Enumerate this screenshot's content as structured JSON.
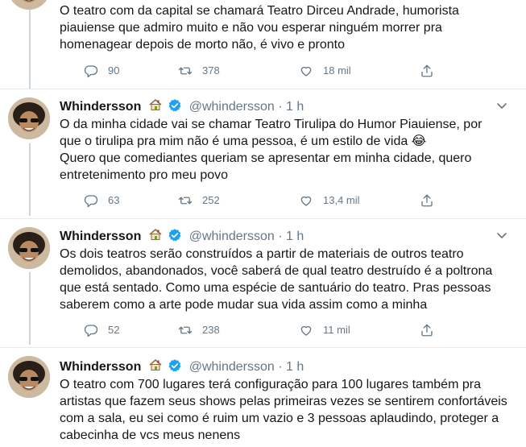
{
  "tweets": [
    {
      "show_header": false,
      "lines": [
        "O teatro com da capital se chamará Teatro Dirceu Andrade, humorista",
        "piauiense que admiro muito e não vou esperar ninguém morrer pra",
        "homenagear depois de morto não, é vivo e pronto"
      ],
      "replies": "90",
      "retweets": "378",
      "likes": "18 mil"
    },
    {
      "show_header": true,
      "name": "Whindersson",
      "handle": "@whindersson",
      "dot": "·",
      "time": "1 h",
      "lines": [
        "O da minha cidade vai se chamar Teatro Tirulipa do Humor Piauiense, por",
        "que o tirulipa pra mim não é uma pessoa, é um estilo de vida 😂",
        "Quero que comediantes queriam se apresentar em minha cidade, quero",
        "entretenimento pro meu povo"
      ],
      "replies": "63",
      "retweets": "252",
      "likes": "13,4 mil"
    },
    {
      "show_header": true,
      "name": "Whindersson",
      "handle": "@whindersson",
      "dot": "·",
      "time": "1 h",
      "lines": [
        "Os dois teatros serão construídos a partir de materiais de outros teatro",
        "demolidos, abandonados, você saberá de qual teatro destruído é a poltrona",
        "que está sentado. Como uma espécie de santuário do teatro. Pras pessoas",
        "saberem como a arte pode mudar sua vida assim como a minha"
      ],
      "replies": "52",
      "retweets": "238",
      "likes": "11 mil"
    },
    {
      "show_header": true,
      "name": "Whindersson",
      "handle": "@whindersson",
      "dot": "·",
      "time": "1 h",
      "lines": [
        "O teatro com 700 lugares terá configuração para 100 lugares também pra",
        "artistas que fazem seus shows pelas primeiras vezes se sentirem confortáveis",
        "com a sala, eu sei como é ruim um vazio e 3 pessoas aplaudindo, proteger a",
        "cabecinha de vcs meus nenens"
      ],
      "replies": "",
      "retweets": "",
      "likes": ""
    }
  ],
  "colors": {
    "text": "#14171a",
    "muted": "#657786",
    "verified": "#1da1f2",
    "divider": "#e6ecf0",
    "thread": "#ccd6dd"
  },
  "icons": [
    "house-emoji-icon",
    "verified-badge-icon",
    "chevron-down-icon",
    "reply-icon",
    "retweet-icon",
    "like-icon",
    "share-icon"
  ]
}
